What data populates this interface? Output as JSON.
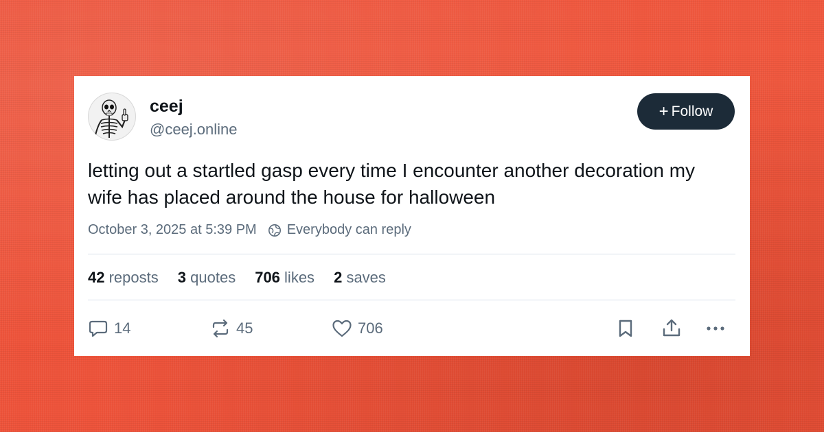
{
  "author": {
    "display_name": "ceej",
    "handle": "@ceej.online",
    "avatar_icon": "skeleton-thumbs-up-avatar"
  },
  "follow_button": {
    "plus": "+",
    "label": "Follow"
  },
  "post": {
    "text": "letting out a startled gasp every time I encounter another decoration my wife has placed around the house for halloween",
    "timestamp": "October 3, 2025 at 5:39 PM",
    "reply_setting": "Everybody can reply",
    "reply_setting_icon": "globe-icon"
  },
  "stats": {
    "reposts_count": "42",
    "reposts_label": "reposts",
    "quotes_count": "3",
    "quotes_label": "quotes",
    "likes_count": "706",
    "likes_label": "likes",
    "saves_count": "2",
    "saves_label": "saves"
  },
  "actions": {
    "reply_count": "14",
    "repost_count": "45",
    "like_count": "706",
    "icons": [
      "reply-icon",
      "repost-icon",
      "like-icon",
      "bookmark-icon",
      "share-icon",
      "more-icon"
    ]
  },
  "colors": {
    "background": "#ee533a",
    "card": "#ffffff",
    "text": "#0f1419",
    "muted": "#5b6b7b",
    "follow_button": "#1c2b38",
    "divider": "#d9e1ea"
  }
}
